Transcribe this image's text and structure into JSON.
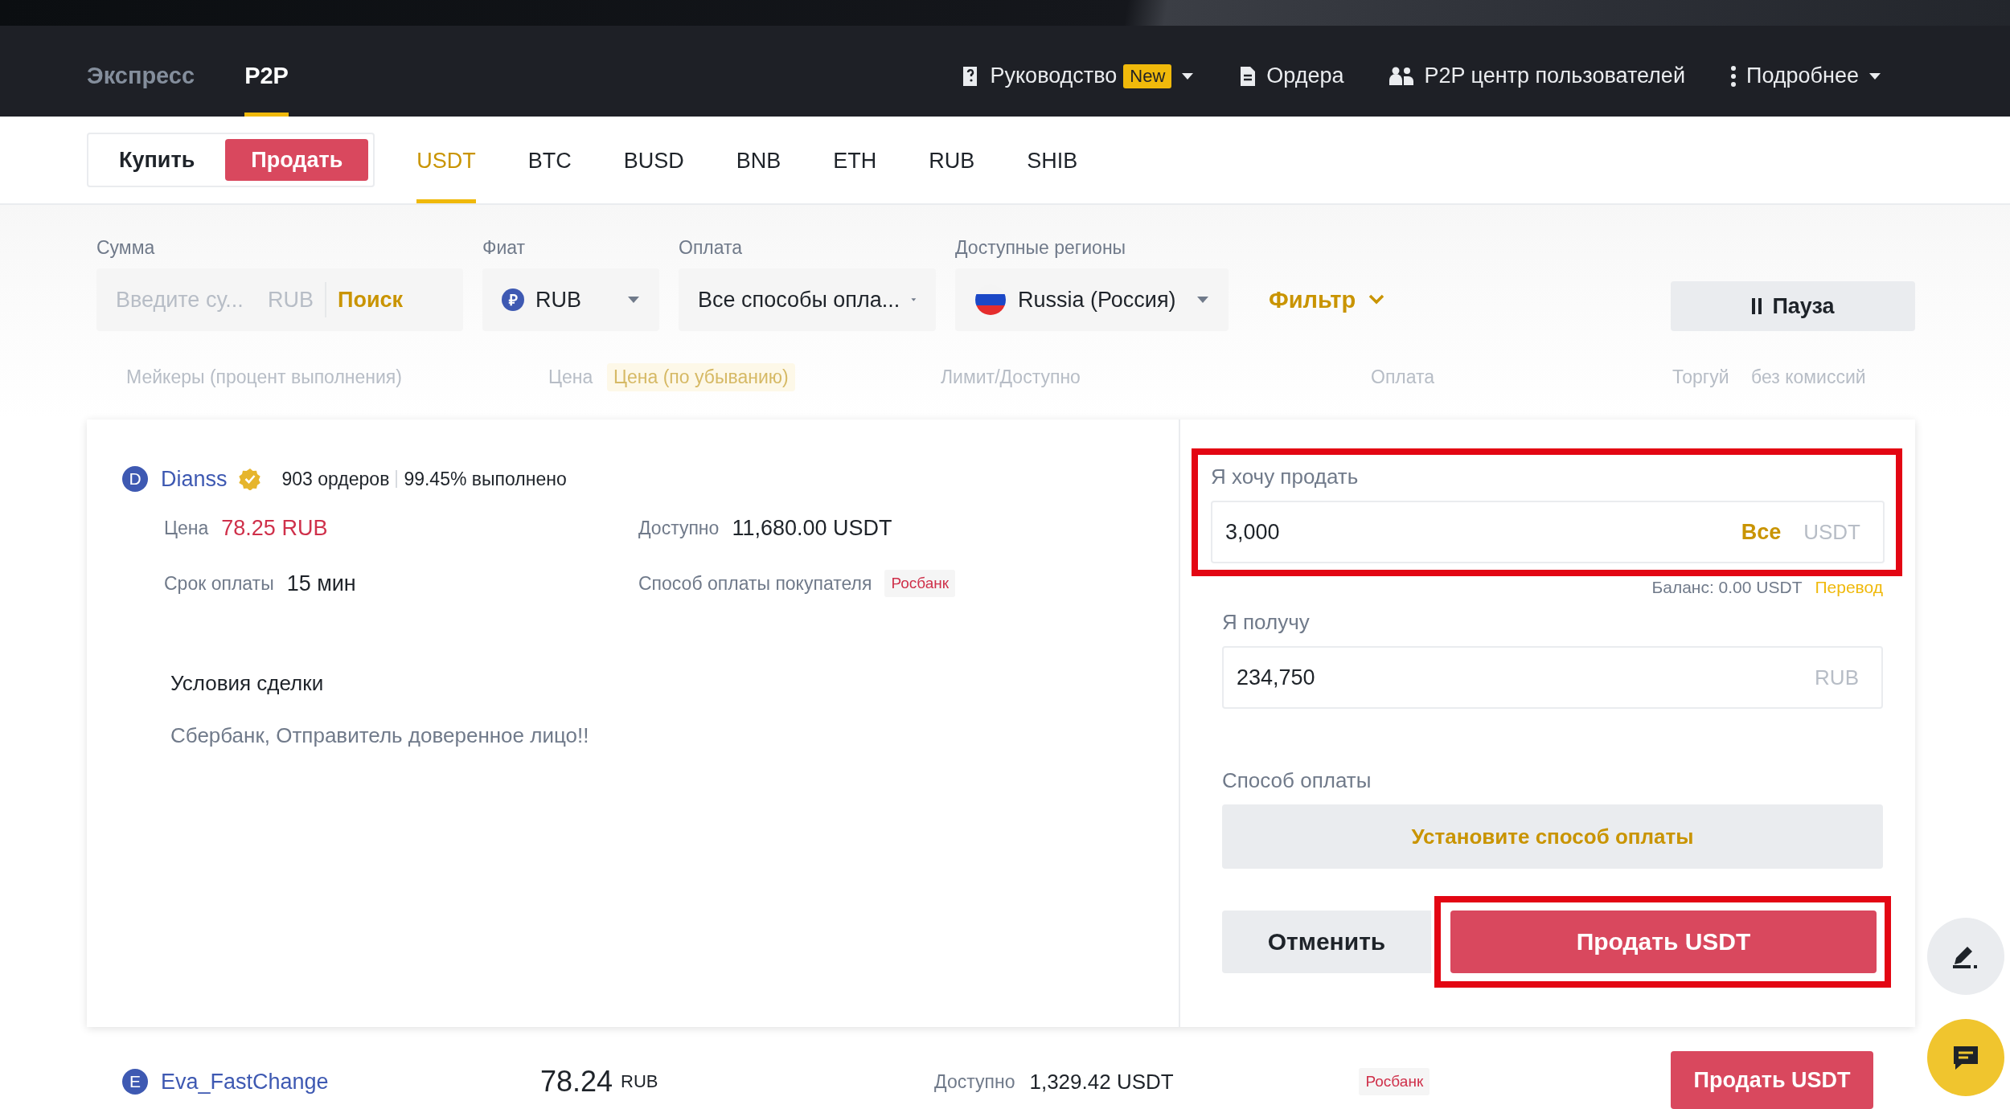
{
  "header": {
    "tabs": [
      {
        "label": "Экспресс",
        "selected": false
      },
      {
        "label": "P2P",
        "selected": true
      }
    ],
    "links": [
      {
        "kind": "guide",
        "label": "Руководство",
        "badge": "New",
        "dropdown": true
      },
      {
        "kind": "orders",
        "label": "Ордера",
        "dropdown": false
      },
      {
        "kind": "users",
        "label": "P2P центр пользователей",
        "dropdown": false
      },
      {
        "kind": "more",
        "label": "Подробнее",
        "dropdown": true
      }
    ]
  },
  "trade_side": [
    {
      "label": "Купить",
      "selected": false
    },
    {
      "label": "Продать",
      "selected": true
    }
  ],
  "assets": [
    {
      "label": "USDT",
      "selected": true
    },
    {
      "label": "BTC",
      "selected": false
    },
    {
      "label": "BUSD",
      "selected": false
    },
    {
      "label": "BNB",
      "selected": false
    },
    {
      "label": "ETH",
      "selected": false
    },
    {
      "label": "RUB",
      "selected": false
    },
    {
      "label": "SHIB",
      "selected": false
    }
  ],
  "filters": {
    "amount": {
      "label": "Сумма",
      "placeholder": "Введите су...",
      "currency": "RUB",
      "action": "Поиск"
    },
    "fiat": {
      "label": "Фиат",
      "symbol": "₽",
      "value": "RUB"
    },
    "payment": {
      "label": "Оплата",
      "value": "Все способы опла..."
    },
    "region": {
      "label": "Доступные регионы",
      "value": "Russia (Россия)"
    },
    "filter_button": "Фильтр",
    "pause_button": "Пауза"
  },
  "columns": [
    {
      "kind": "text",
      "label": "Мейкеры (процент выполнения)"
    },
    {
      "kind": "text",
      "label": "Цена"
    },
    {
      "kind": "sort",
      "label": "Цена (по убыванию)"
    },
    {
      "kind": "text",
      "label": "Лимит/Доступно"
    },
    {
      "kind": "text",
      "label": "Оплата"
    },
    {
      "kind": "text",
      "label": "Торгуй"
    },
    {
      "kind": "text",
      "label": "без комиссий"
    }
  ],
  "offer": {
    "avatar": "D",
    "name": "Dianss",
    "verified": true,
    "orders": "903 ордеров",
    "completion": "99.45% выполнено",
    "price_label": "Цена",
    "price": "78.25 RUB",
    "available_label": "Доступно",
    "available": "11,680.00 USDT",
    "term_label": "Срок оплаты",
    "term": "15 мин",
    "method_label": "Способ оплаты покупателя",
    "method_tag": "Росбанк",
    "terms_title": "Условия сделки",
    "terms_text": "Сбербанк, Отправитель доверенное лицо!!",
    "form": {
      "sell_label": "Я хочу продать",
      "sell_value": "3,000",
      "all_button": "Все",
      "sell_currency": "USDT",
      "sell_highlighted": true,
      "balance": "Баланс: 0.00 USDT",
      "transfer_link": "Перевод",
      "receive_label": "Я получу",
      "receive_value": "234,750",
      "receive_currency": "RUB",
      "method_label": "Способ оплаты",
      "method_button": "Установите способ оплаты",
      "cancel_button": "Отменить",
      "submit_button": "Продать USDT",
      "submit_highlighted": true
    }
  },
  "next_offer": {
    "avatar": "E",
    "name": "Eva_FastChange",
    "price": "78.24",
    "currency": "RUB",
    "available_label": "Доступно",
    "available": "1,329.42 USDT",
    "method_tag": "Росбанк",
    "button": "Продать USDT"
  }
}
